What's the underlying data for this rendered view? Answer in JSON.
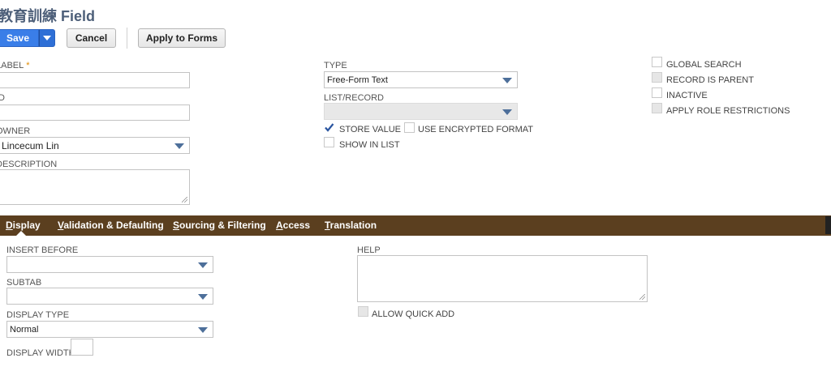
{
  "page": {
    "title": "教育訓練 Field"
  },
  "toolbar": {
    "save_label": "Save",
    "cancel_label": "Cancel",
    "apply_label": "Apply to Forms"
  },
  "main": {
    "label": {
      "label": "LABEL",
      "required_mark": "*",
      "value": ""
    },
    "id": {
      "label": "ID",
      "value": ""
    },
    "owner": {
      "label": "OWNER",
      "value": "Lincecum Lin"
    },
    "description": {
      "label": "DESCRIPTION",
      "value": ""
    },
    "type": {
      "label": "TYPE",
      "value": "Free-Form Text"
    },
    "list_record": {
      "label": "LIST/RECORD",
      "value": ""
    },
    "store_value": {
      "label": "STORE VALUE",
      "checked": true
    },
    "use_encrypted": {
      "label": "USE ENCRYPTED FORMAT",
      "checked": false
    },
    "show_in_list": {
      "label": "SHOW IN LIST",
      "checked": false
    },
    "global_search": {
      "label": "GLOBAL SEARCH",
      "checked": false
    },
    "record_is_parent": {
      "label": "RECORD IS PARENT",
      "checked": false,
      "disabled": true
    },
    "inactive": {
      "label": "INACTIVE",
      "checked": false
    },
    "apply_role": {
      "label": "APPLY ROLE RESTRICTIONS",
      "checked": false,
      "disabled": true
    }
  },
  "tabs": [
    {
      "first": "D",
      "rest": "isplay",
      "active": true
    },
    {
      "first": "V",
      "rest": "alidation & Defaulting",
      "active": false
    },
    {
      "first": "S",
      "rest": "ourcing & Filtering",
      "active": false
    },
    {
      "first": "A",
      "rest": "ccess",
      "active": false
    },
    {
      "first": "T",
      "rest": "ranslation",
      "active": false
    }
  ],
  "display": {
    "insert_before": {
      "label": "INSERT BEFORE",
      "value": ""
    },
    "subtab": {
      "label": "SUBTAB",
      "value": ""
    },
    "display_type": {
      "label": "DISPLAY TYPE",
      "value": "Normal"
    },
    "display_width": {
      "label": "DISPLAY WIDTH",
      "value": ""
    },
    "help": {
      "label": "HELP",
      "value": ""
    },
    "allow_quick_add": {
      "label": "ALLOW QUICK ADD",
      "checked": false
    }
  },
  "colors": {
    "accent": "#3a7ee8",
    "tabbar": "#5b3f1f",
    "title": "#4d5f79",
    "caret": "#4d6f9a"
  },
  "icons": {
    "dropdown": "caret-down-icon",
    "checkbox_checked": "checkmark-icon"
  }
}
